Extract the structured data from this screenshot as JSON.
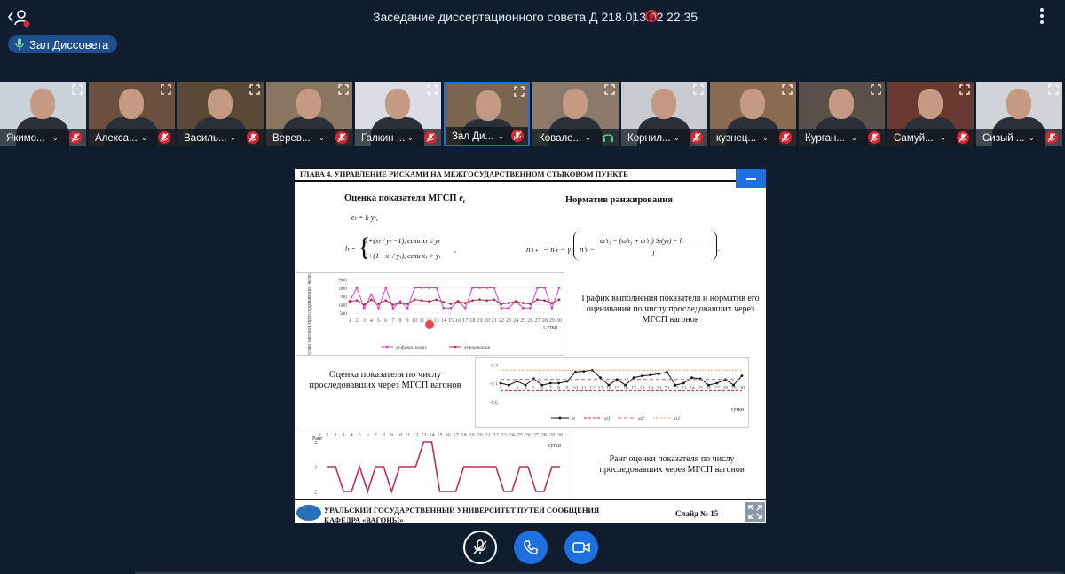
{
  "header": {
    "meeting_title": "Заседание диссертационного совета Д 218.013.02",
    "time": "22:35",
    "room_name": "Зал Диссовета"
  },
  "participants": [
    {
      "name": "Якимо...",
      "mic": "muted",
      "bg": "#c9d2d9"
    },
    {
      "name": "Алекса...",
      "mic": "muted",
      "bg": "#6b5040"
    },
    {
      "name": "Василь...",
      "mic": "muted",
      "bg": "#5a4a35"
    },
    {
      "name": "Верев...",
      "mic": "muted",
      "bg": "#8a7560"
    },
    {
      "name": "Галкин ...",
      "mic": "muted",
      "bg": "#d9dde3"
    },
    {
      "name": "Зал Ди...",
      "mic": "muted",
      "bg": "#7a6550"
    },
    {
      "name": "Ковале...",
      "mic": "headset",
      "bg": "#8a7a6a"
    },
    {
      "name": "Корнил...",
      "mic": "muted",
      "bg": "#c8ccd0"
    },
    {
      "name": "кузнец...",
      "mic": "muted",
      "bg": "#8a6a50"
    },
    {
      "name": "Курган...",
      "mic": "muted",
      "bg": "#5a5048"
    },
    {
      "name": "Самуй...",
      "mic": "muted",
      "bg": "#6a3a30"
    },
    {
      "name": "Сизый ...",
      "mic": "muted",
      "bg": "#d0d4d8"
    }
  ],
  "slide": {
    "chapter_header": "ГЛАВА 4. УПРАВЛЕНИЕ РИСКАМИ НА МЕЖГОСУДАРСТВЕННОМ СТЫКОВОМ ПУНКТЕ",
    "left_title": "Оценка показателя МГСП",
    "left_title_var": "e",
    "left_title_sub": "t",
    "right_title": "Норматив ранжирования",
    "formula_e": "eₜ = lₜ yₜ,",
    "formula_l_prefix": "lₜ =",
    "formula_l_case1": "1+(xₜ / yₜ −1),   если   xₜ ≤ yₜ",
    "formula_l_case2": "1+(1− xₜ / yₜ),   если   xₜ > yₜ",
    "formula_l_comma": ",",
    "formula_n_left": "nⁱₜ₊₁ = nⁱₜ − γₜ",
    "formula_n_num": "ωⁱₜ₃ − (ωⁱₜ₃ + ωⁱₜ₁) Sₜ(yₜ) − h",
    "formula_n_inner": "nⁱₜ −",
    "formula_n_den": "l",
    "formula_n_end": ".",
    "graph_caption": "График выполнения показателя и норматив его оценивания по числу проследовавших через МГСП вагонов",
    "mid_caption": "Оценка показателя по числу проследовавших через МГСП вагонов",
    "rank_caption": "Ранг оценки показателя по числу проследовавших через МГСП вагонов",
    "footer_university": "УРАЛЬСКИЙ ГОСУДАРСТВЕННЫЙ УНИВЕРСИТЕТ ПУТЕЙ СООБЩЕНИЯ",
    "footer_dept": "КАФЕДРА «ВАГОНЫ»",
    "slide_number": "Слайд № 15"
  },
  "chart_data": [
    {
      "type": "line",
      "ylabel": "Количество вагонов проследовавших через МГСП",
      "xlabel": "Сутки",
      "x": [
        1,
        2,
        3,
        4,
        5,
        6,
        7,
        8,
        9,
        10,
        11,
        12,
        13,
        14,
        15,
        16,
        17,
        18,
        19,
        20,
        21,
        22,
        23,
        24,
        25,
        26,
        27,
        28,
        29,
        30
      ],
      "ylim": [
        500,
        900
      ],
      "yticks": [
        500,
        600,
        700,
        800,
        900
      ],
      "series": [
        {
          "name": "yt-факт. показ",
          "color": "#e040c0",
          "values": [
            640,
            800,
            560,
            720,
            560,
            800,
            560,
            640,
            560,
            800,
            800,
            800,
            800,
            560,
            560,
            640,
            560,
            800,
            800,
            800,
            800,
            560,
            560,
            640,
            560,
            560,
            800,
            800,
            560,
            800
          ]
        },
        {
          "name": "xt-норматив",
          "color": "#b0304a",
          "values": [
            640,
            650,
            600,
            660,
            610,
            650,
            600,
            620,
            610,
            660,
            650,
            640,
            660,
            630,
            610,
            640,
            620,
            650,
            660,
            650,
            660,
            610,
            620,
            640,
            620,
            610,
            660,
            650,
            620,
            660
          ]
        }
      ]
    },
    {
      "type": "line",
      "xlabel": "сутки",
      "x": [
        1,
        2,
        3,
        4,
        5,
        6,
        7,
        8,
        9,
        10,
        11,
        12,
        13,
        14,
        15,
        16,
        17,
        18,
        19,
        20,
        21,
        22,
        23,
        24,
        25,
        26,
        27,
        28,
        29,
        30
      ],
      "ylim": [
        -0.6,
        0.4
      ],
      "yticks": [
        0.4,
        -0.1,
        -0.6
      ],
      "series": [
        {
          "name": "et",
          "color": "#111111",
          "values": [
            -0.1,
            -0.15,
            -0.05,
            -0.15,
            0.02,
            -0.15,
            -0.1,
            -0.1,
            -0.05,
            0.2,
            0.22,
            0.25,
            0.05,
            -0.15,
            0.0,
            -0.15,
            0.05,
            0.1,
            0.12,
            0.15,
            0.2,
            -0.15,
            -0.1,
            0.05,
            0.02,
            -0.15,
            -0.1,
            0.0,
            -0.15,
            0.1
          ]
        },
        {
          "name": "xt1",
          "color": "#c02040",
          "values": [
            -0.3,
            -0.3,
            -0.3,
            -0.3,
            -0.3,
            -0.3,
            -0.3,
            -0.3,
            -0.3,
            -0.3,
            -0.3,
            -0.3,
            -0.3,
            -0.3,
            -0.3,
            -0.3,
            -0.3,
            -0.3,
            -0.3,
            -0.3,
            -0.3,
            -0.3,
            -0.3,
            -0.3,
            -0.3,
            -0.3,
            -0.3,
            -0.3,
            -0.3,
            -0.3
          ]
        },
        {
          "name": "xt2",
          "color": "#c06080",
          "values": [
            0,
            0,
            0,
            0,
            0,
            0,
            0,
            0,
            0,
            0,
            0,
            0,
            0,
            0,
            0,
            0,
            0,
            0,
            0,
            0,
            0,
            0,
            0,
            0,
            0,
            0,
            0,
            0,
            0,
            0
          ]
        },
        {
          "name": "xt3",
          "color": "#e09030",
          "values": [
            0.25,
            0.25,
            0.25,
            0.25,
            0.25,
            0.25,
            0.25,
            0.25,
            0.25,
            0.25,
            0.25,
            0.25,
            0.25,
            0.25,
            0.25,
            0.25,
            0.25,
            0.25,
            0.25,
            0.25,
            0.25,
            0.25,
            0.25,
            0.25,
            0.25,
            0.25,
            0.25,
            0.25,
            0.25,
            0.25
          ]
        }
      ]
    },
    {
      "type": "line",
      "ylabel": "Ранг",
      "xlabel": "сутки",
      "x": [
        0,
        1,
        2,
        3,
        4,
        5,
        6,
        7,
        8,
        9,
        10,
        11,
        12,
        13,
        14,
        15,
        16,
        17,
        18,
        19,
        20,
        21,
        22,
        23,
        24,
        25,
        26,
        27,
        28,
        29,
        30
      ],
      "ylim": [
        2,
        4
      ],
      "yticks": [
        4,
        3,
        2
      ],
      "series": [
        {
          "name": "rank",
          "color": "#b8305a",
          "values": [
            null,
            3,
            3,
            2,
            2,
            3,
            2,
            3,
            3,
            2,
            3,
            3,
            3,
            4,
            4,
            2,
            2,
            2,
            3,
            3,
            3,
            3,
            3,
            2,
            2,
            3,
            3,
            2,
            2,
            3,
            3
          ]
        }
      ]
    }
  ]
}
